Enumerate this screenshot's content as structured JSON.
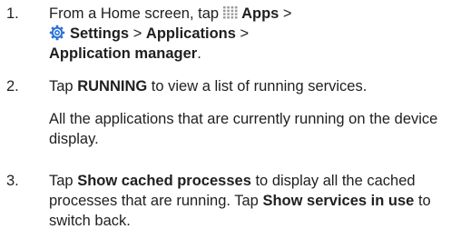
{
  "steps": [
    {
      "number": "1.",
      "line1_pre": "From a Home screen, tap",
      "apps_icon": "apps-grid-icon",
      "apps_label": "Apps",
      "sep1": ">",
      "settings_icon": "settings-gear-icon",
      "settings_label": "Settings",
      "sep2": ">",
      "applications_label": "Applications",
      "sep3": ">",
      "app_manager_label": "Application manager",
      "end": "."
    },
    {
      "number": "2.",
      "action": "Tap",
      "running_label": "RUNNING",
      "text_after": "to view a list of running services.",
      "note": "All the applications that are currently running on the device display."
    },
    {
      "number": "3.",
      "action": "Tap",
      "cached_label": "Show cached processes",
      "text_mid": "to display all the cached processes that are running. Tap",
      "services_label": "Show services in use",
      "text_end": "to switch back."
    }
  ],
  "colors": {
    "text": "#1f1f1f",
    "icon_gray": "#9a9a9a",
    "icon_blue": "#2a73d9"
  }
}
